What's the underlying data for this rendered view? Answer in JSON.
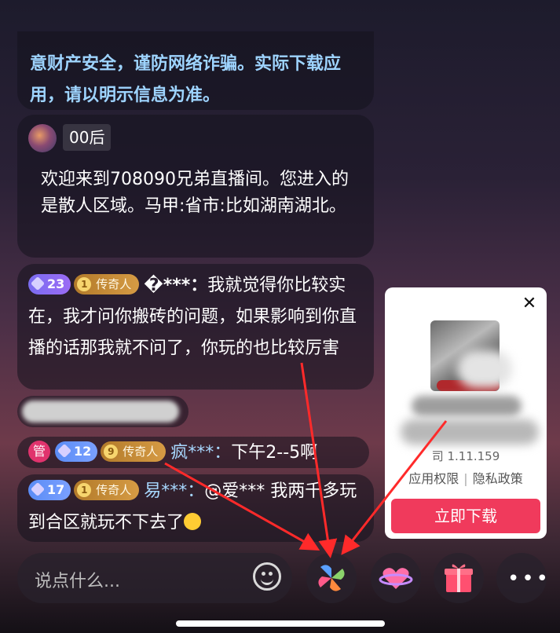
{
  "notice": {
    "text": "意财产安全，谨防网络诈骗。实际下载应用，请以明示信息为准。"
  },
  "welcome": {
    "username": "00后",
    "text": "欢迎来到708090兄弟直播间。您进入的是散人区域。马甲:省市:比如湖南湖北。"
  },
  "chat": [
    {
      "level": "23",
      "rank": "传奇人",
      "rank_icon": "1",
      "user": "�***：",
      "text": "我就觉得你比较实在，我才问你搬砖的问题，如果影响到你直播的话那我就不问了，你玩的也比较厉害"
    },
    {
      "admin": "管",
      "level": "12",
      "rank": "传奇人",
      "rank_icon": "9",
      "user": "疯***：",
      "text": "下午2--5啊"
    },
    {
      "level": "17",
      "rank": "传奇人",
      "rank_icon": "1",
      "user": "易***：",
      "text": "@爱*** 我两千多玩到合区就玩不下去了"
    }
  ],
  "ad": {
    "close": "✕",
    "version": "司 1.11.159",
    "link_permissions": "应用权限",
    "separator": "|",
    "link_privacy": "隐私政策",
    "download": "立即下载"
  },
  "bottom": {
    "placeholder": "说点什么...",
    "icons": [
      "smile-icon",
      "pinwheel-icon",
      "heart-planet-icon",
      "gift-icon",
      "more-icon"
    ],
    "more": "•••"
  },
  "colors": {
    "accent": "#f03a5c",
    "notice_text": "#9ed4ff",
    "rank_badge": "#c98a3a"
  }
}
